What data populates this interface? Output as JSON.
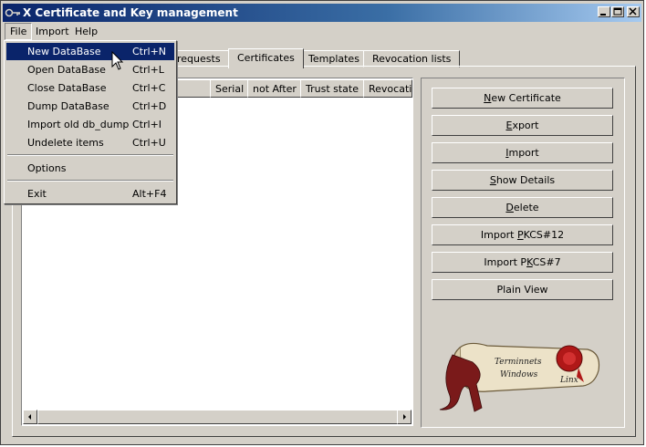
{
  "window": {
    "title": "X Certificate and Key management"
  },
  "menubar": {
    "items": [
      "File",
      "Import",
      "Help"
    ]
  },
  "file_menu": {
    "items": [
      {
        "label": "New DataBase",
        "shortcut": "Ctrl+N"
      },
      {
        "label": "Open DataBase",
        "shortcut": "Ctrl+L"
      },
      {
        "label": "Close DataBase",
        "shortcut": "Ctrl+C"
      },
      {
        "label": "Dump DataBase",
        "shortcut": "Ctrl+D"
      },
      {
        "label": "Import old db_dump",
        "shortcut": "Ctrl+I"
      },
      {
        "label": "Undelete items",
        "shortcut": "Ctrl+U"
      },
      {
        "label": "Options",
        "shortcut": ""
      },
      {
        "label": "Exit",
        "shortcut": "Alt+F4"
      }
    ]
  },
  "tabs": [
    "requests",
    "Certificates",
    "Templates",
    "Revocation lists"
  ],
  "active_tab": "Certificates",
  "list": {
    "columns": [
      "ame",
      "Serial",
      "not After",
      "Trust state",
      "Revocatio"
    ]
  },
  "buttons": {
    "new_certificate": {
      "pre": "",
      "u": "N",
      "post": "ew Certificate"
    },
    "export": {
      "pre": "",
      "u": "E",
      "post": "xport"
    },
    "import": {
      "pre": "",
      "u": "I",
      "post": "mport"
    },
    "show_details": {
      "pre": "",
      "u": "S",
      "post": "how Details"
    },
    "delete": {
      "pre": "",
      "u": "D",
      "post": "elete"
    },
    "import_pkcs12": {
      "pre": "Import ",
      "u": "P",
      "post": "KCS#12"
    },
    "import_pkcs7": {
      "pre": "Import P",
      "u": "K",
      "post": "CS#7"
    },
    "plain_view": {
      "pre": "Plain View",
      "u": "",
      "post": ""
    }
  },
  "logo": {
    "text_line1": "Terminnets",
    "text_line2": "Windows",
    "text_line3": "Linx"
  },
  "colors": {
    "titlebar": "#0a246a",
    "face": "#d4d0c8",
    "highlight": "#0a246a",
    "seal": "#b01818",
    "ribbon": "#7a1a1a"
  }
}
